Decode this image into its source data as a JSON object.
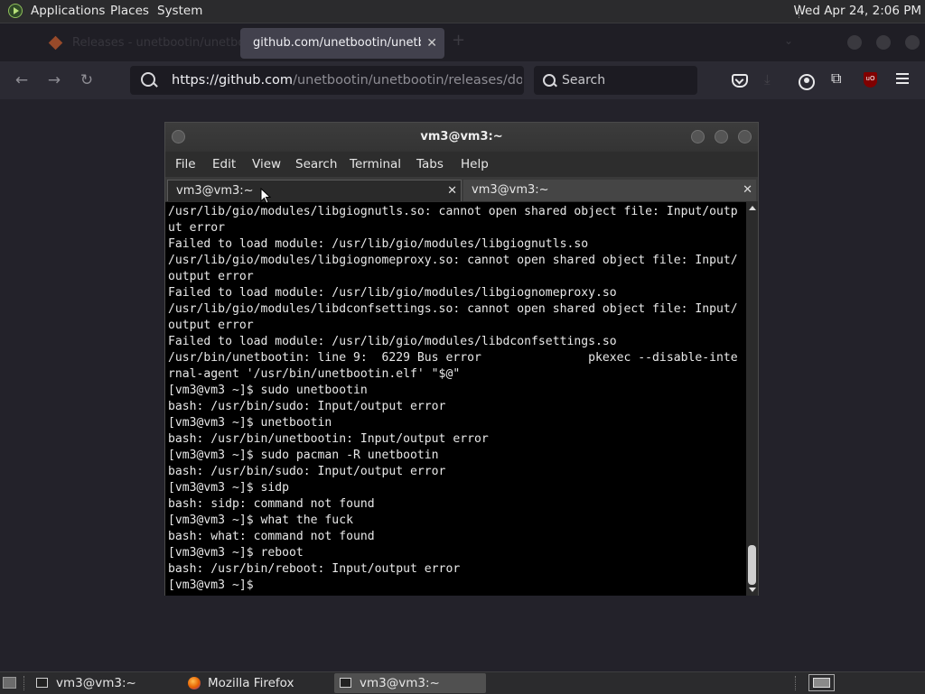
{
  "top_panel": {
    "menus": [
      "Applications",
      "Places",
      "System"
    ],
    "clock": "Wed Apr 24,  2:06 PM"
  },
  "firefox": {
    "inactive_tab_title": "Releases - unetbootin/unetbootin",
    "active_tab_title": "github.com/unetbootin/unetbootin",
    "url_host": "https://github.com",
    "url_path": "/unetbootin/unetbootin/releases/download",
    "search_placeholder": "Search"
  },
  "terminal": {
    "window_title": "vm3@vm3:~",
    "menu": [
      "File",
      "Edit",
      "View",
      "Search",
      "Terminal",
      "Tabs",
      "Help"
    ],
    "tabs": [
      {
        "label": "vm3@vm3:~",
        "active": true
      },
      {
        "label": "vm3@vm3:~",
        "active": false
      }
    ],
    "lines": [
      "/usr/lib/gio/modules/libgiognutls.so: cannot open shared object file: Input/outp",
      "ut error",
      "Failed to load module: /usr/lib/gio/modules/libgiognutls.so",
      "/usr/lib/gio/modules/libgiognomeproxy.so: cannot open shared object file: Input/",
      "output error",
      "Failed to load module: /usr/lib/gio/modules/libgiognomeproxy.so",
      "/usr/lib/gio/modules/libdconfsettings.so: cannot open shared object file: Input/",
      "output error",
      "Failed to load module: /usr/lib/gio/modules/libdconfsettings.so",
      "/usr/bin/unetbootin: line 9:  6229 Bus error               pkexec --disable-inte",
      "rnal-agent '/usr/bin/unetbootin.elf' \"$@\"",
      "[vm3@vm3 ~]$ sudo unetbootin",
      "bash: /usr/bin/sudo: Input/output error",
      "[vm3@vm3 ~]$ unetbootin",
      "bash: /usr/bin/unetbootin: Input/output error",
      "[vm3@vm3 ~]$ sudo pacman -R unetbootin",
      "bash: /usr/bin/sudo: Input/output error",
      "[vm3@vm3 ~]$ sidp",
      "bash: sidp: command not found",
      "[vm3@vm3 ~]$ what the fuck",
      "bash: what: command not found",
      "[vm3@vm3 ~]$ reboot",
      "bash: /usr/bin/reboot: Input/output error",
      "[vm3@vm3 ~]$"
    ]
  },
  "taskbar": {
    "items": [
      {
        "label": "vm3@vm3:~",
        "icon": "terminal-icon",
        "active": false
      },
      {
        "label": "Mozilla Firefox",
        "icon": "firefox-icon",
        "active": false
      },
      {
        "label": "vm3@vm3:~",
        "icon": "terminal-icon",
        "active": true
      }
    ]
  }
}
